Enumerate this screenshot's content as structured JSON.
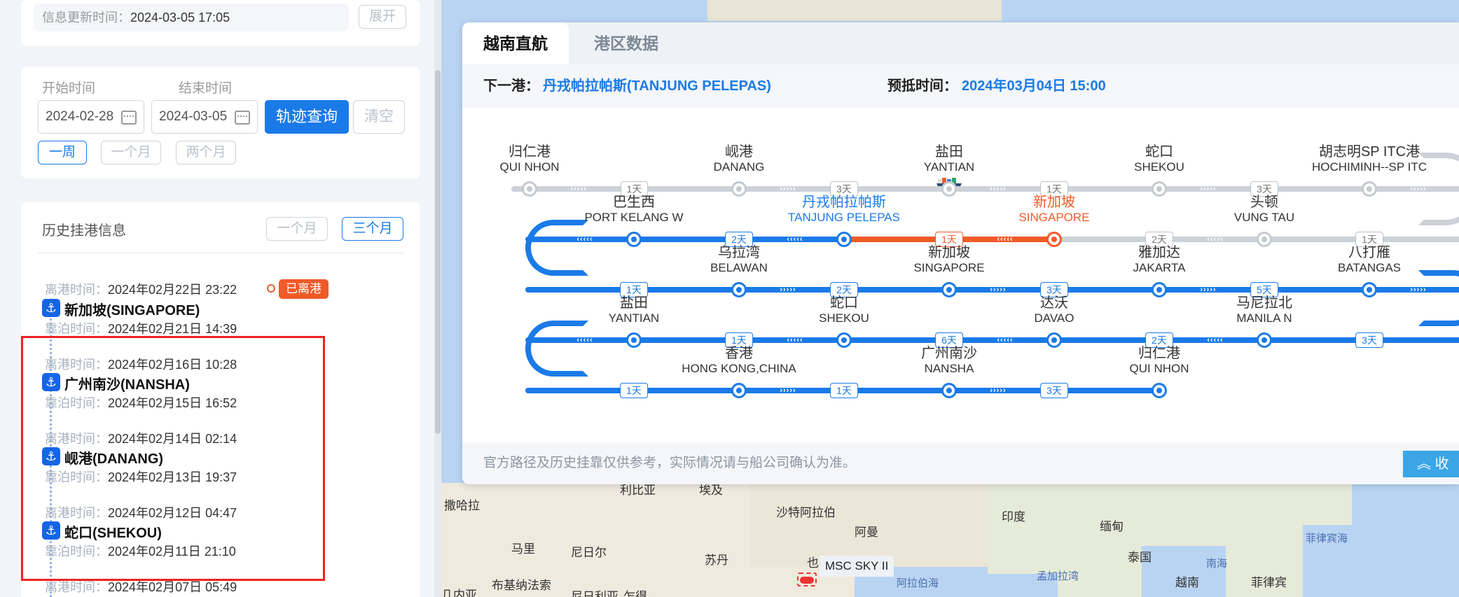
{
  "left_panel": {
    "info_card": {
      "update_label": "信息更新时间：",
      "update_value": "2024-03-05 17:05",
      "expand_button": "展开"
    },
    "query_card": {
      "start_label": "开始时间",
      "end_label": "结束时间",
      "start_value": "2024-02-28",
      "end_value": "2024-03-05",
      "query_button": "轨迹查询",
      "clear_button": "清空",
      "ranges": [
        "一周",
        "一个月",
        "两个月"
      ]
    },
    "history": {
      "title": "历史挂港信息",
      "ranges": [
        "一个月",
        "三个月"
      ],
      "depart_label": "离港时间：",
      "arrive_label": "靠泊时间：",
      "departed_badge": "已离港",
      "items": [
        {
          "port": "新加坡(SINGAPORE)",
          "depart": "2024年02月22日 23:22",
          "arrive": "2024年02月21日 14:39"
        },
        {
          "port": "广州南沙(NANSHA)",
          "depart": "2024年02月16日 10:28",
          "arrive": "2024年02月15日 16:52"
        },
        {
          "port": "岘港(DANANG)",
          "depart": "2024年02月14日 02:14",
          "arrive": "2024年02月13日 19:37"
        },
        {
          "port": "蛇口(SHEKOU)",
          "depart": "2024年02月12日 04:47",
          "arrive": "2024年02月11日 21:10"
        }
      ],
      "partial_depart": "2024年02月07日 05:49"
    }
  },
  "panel": {
    "tabs": [
      "越南直航",
      "港区数据"
    ],
    "next_port_label": "下一港：",
    "next_port_value": "丹戎帕拉帕斯(TANJUNG PELEPAS)",
    "eta_label": "预抵时间：",
    "eta_value": "2024年03月04日 15:00",
    "footnote": "官方路径及历史挂靠仅供参考，实际情况请与船公司确认为准。",
    "collapse": "收",
    "rows": [
      {
        "ports": [
          [
            "归仁港",
            "QUI NHON"
          ],
          [
            "岘港",
            "DANANG"
          ],
          [
            "盐田",
            "YANTIAN"
          ],
          [
            "蛇口",
            "SHEKOU"
          ],
          [
            "胡志明SP ITC港",
            "HOCHIMINH--SP ITC"
          ]
        ],
        "days": [
          "1天",
          "3天",
          "1天",
          "3天"
        ]
      },
      {
        "ports": [
          [
            "巴生西",
            "PORT KELANG W"
          ],
          [
            "丹戎帕拉帕斯",
            "TANJUNG PELEPAS"
          ],
          [
            "新加坡",
            "SINGAPORE"
          ],
          [
            "头顿",
            "VUNG TAU"
          ]
        ],
        "days": [
          "2天",
          "1天",
          "2天",
          "1天"
        ]
      },
      {
        "ports": [
          [
            "乌拉湾",
            "BELAWAN"
          ],
          [
            "新加坡",
            "SINGAPORE"
          ],
          [
            "雅加达",
            "JAKARTA"
          ],
          [
            "八打雁",
            "BATANGAS"
          ]
        ],
        "days": [
          "1天",
          "2天",
          "3天",
          "5天"
        ]
      },
      {
        "ports": [
          [
            "盐田",
            "YANTIAN"
          ],
          [
            "蛇口",
            "SHEKOU"
          ],
          [
            "达沃",
            "DAVAO"
          ],
          [
            "马尼拉北",
            "MANILA N"
          ]
        ],
        "days": [
          "1天",
          "6天",
          "2天",
          "3天"
        ]
      },
      {
        "ports": [
          [
            "香港",
            "HONG KONG,CHINA"
          ],
          [
            "广州南沙",
            "NANSHA"
          ],
          [
            "归仁港",
            "QUI NHON"
          ]
        ],
        "days": [
          "1天",
          "1天",
          "3天"
        ]
      }
    ]
  },
  "map": {
    "labels": [
      "撒哈拉",
      "利比亚",
      "埃及",
      "沙特阿拉伯",
      "印度",
      "缅甸",
      "阿曼",
      "马里",
      "尼日尔",
      "苏丹",
      "也门",
      "泰国",
      "菲律宾海",
      "南海",
      "越南",
      "菲律宾",
      "布基纳法索",
      "尼日利亚",
      "乍得",
      "几内亚"
    ],
    "sea_labels": [
      "孟加拉湾",
      "阿拉伯海"
    ],
    "vessel_name": "MSC SKY II"
  }
}
